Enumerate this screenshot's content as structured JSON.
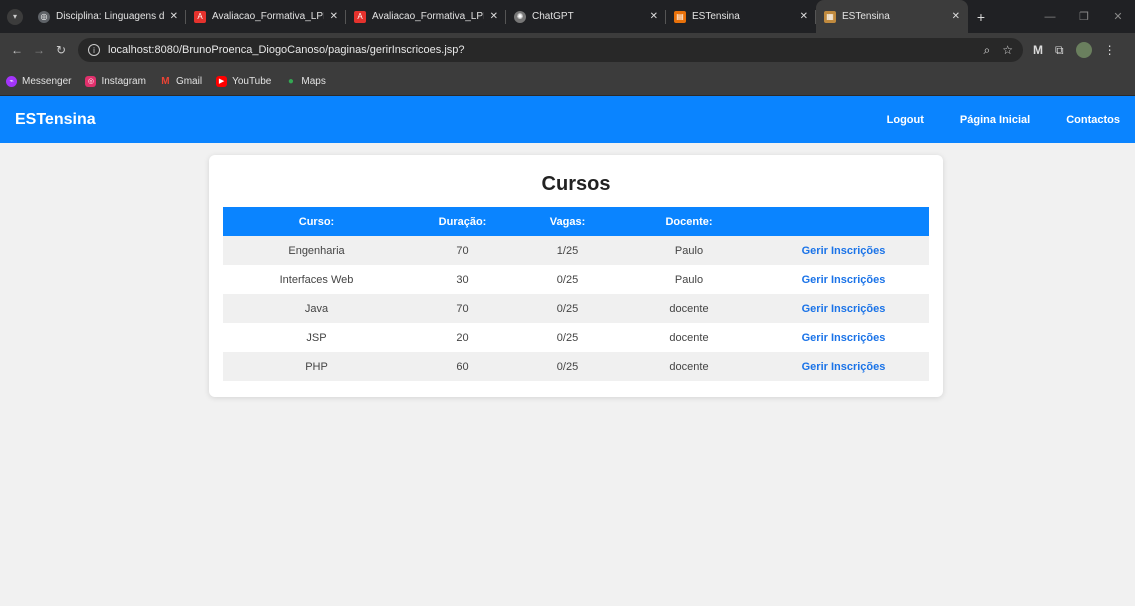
{
  "browser": {
    "tabs": [
      {
        "title": "Disciplina: Linguagens de",
        "favicon": "globe-icon",
        "color": "#5f6368",
        "active": false
      },
      {
        "title": "Avaliacao_Formativa_LPI_I",
        "favicon": "pdf-icon",
        "color": "#e5322d",
        "active": false
      },
      {
        "title": "Avaliacao_Formativa_LPI_I",
        "favicon": "pdf-icon",
        "color": "#e5322d",
        "active": false
      },
      {
        "title": "ChatGPT",
        "favicon": "chatgpt-icon",
        "color": "#777777",
        "active": false
      },
      {
        "title": "ESTensina",
        "favicon": "estensina-icon",
        "color": "#e8710a",
        "active": false
      },
      {
        "title": "ESTensina",
        "favicon": "estensina-icon",
        "color": "#c08a3e",
        "active": true
      }
    ],
    "url": "localhost:8080/BrunoProenca_DiogoCanoso/paginas/gerirInscricoes.jsp?",
    "bookmarks": [
      {
        "label": "Messenger",
        "icon": "messenger-icon",
        "color": "#a334fa"
      },
      {
        "label": "Instagram",
        "icon": "instagram-icon",
        "color": "#e1306c"
      },
      {
        "label": "Gmail",
        "icon": "gmail-icon",
        "color": "#ea4335"
      },
      {
        "label": "YouTube",
        "icon": "youtube-icon",
        "color": "#ff0000"
      },
      {
        "label": "Maps",
        "icon": "maps-icon",
        "color": "#34a853"
      }
    ]
  },
  "header": {
    "logo": "ESTensina",
    "nav": [
      "Logout",
      "Página Inicial",
      "Contactos"
    ],
    "color": "#0a84ff"
  },
  "main": {
    "title": "Cursos",
    "columns": [
      "Curso:",
      "Duração:",
      "Vagas:",
      "Docente:",
      ""
    ],
    "rows": [
      {
        "curso": "Engenharia",
        "duracao": "70",
        "vagas": "1/25",
        "docente": "Paulo",
        "action": "Gerir Inscrições"
      },
      {
        "curso": "Interfaces Web",
        "duracao": "30",
        "vagas": "0/25",
        "docente": "Paulo",
        "action": "Gerir Inscrições"
      },
      {
        "curso": "Java",
        "duracao": "70",
        "vagas": "0/25",
        "docente": "docente",
        "action": "Gerir Inscrições"
      },
      {
        "curso": "JSP",
        "duracao": "20",
        "vagas": "0/25",
        "docente": "docente",
        "action": "Gerir Inscrições"
      },
      {
        "curso": "PHP",
        "duracao": "60",
        "vagas": "0/25",
        "docente": "docente",
        "action": "Gerir Inscrições"
      }
    ]
  }
}
